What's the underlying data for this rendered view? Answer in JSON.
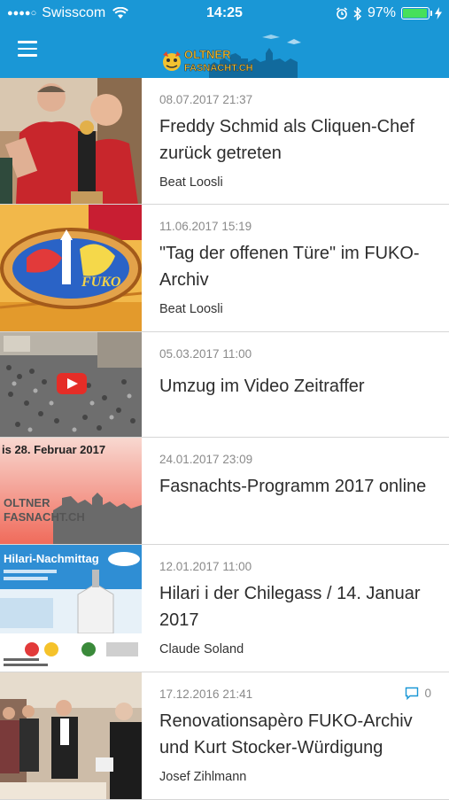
{
  "status_bar": {
    "signal_dots": "●●●●○",
    "carrier": "Swisscom",
    "time": "14:25",
    "battery": "97%",
    "battery_level": 0.97,
    "battery_color": "#46e05a"
  },
  "nav": {
    "menu_icon": "hamburger-icon",
    "logo_text_line1": "OLTNER",
    "logo_text_line2": "FASNACHT.CH",
    "bar_color": "#1a97d6"
  },
  "feed": [
    {
      "date": "08.07.2017 21:37",
      "title": "Freddy Schmid als Cliquen-Chef zurück getreten",
      "author": "Beat Loosli"
    },
    {
      "date": "11.06.2017 15:19",
      "title": "\"Tag der offenen Türe\" im FUKO-Archiv",
      "author": "Beat Loosli",
      "thumb_text": "FUKO"
    },
    {
      "date": "05.03.2017 11:00",
      "title": "Umzug im Video Zeitraffer",
      "author": ""
    },
    {
      "date": "24.01.2017 23:09",
      "title": "Fasnachts-Programm 2017 online",
      "author": "",
      "thumb_banner": "is 28. Februar 2017",
      "thumb_logo1": "OLTNER",
      "thumb_logo2": "FASNACHT.CH"
    },
    {
      "date": "12.01.2017 11:00",
      "title": "Hilari i der Chilegass / 14. Januar 2017",
      "author": "Claude Soland",
      "thumb_banner": "Hilari-Nachmittag"
    },
    {
      "date": "17.12.2016 21:41",
      "title": "Renovationsapèro FUKO-Archiv und Kurt Stocker-Würdigung",
      "author": "Josef Zihlmann",
      "comment_count": "0"
    }
  ]
}
